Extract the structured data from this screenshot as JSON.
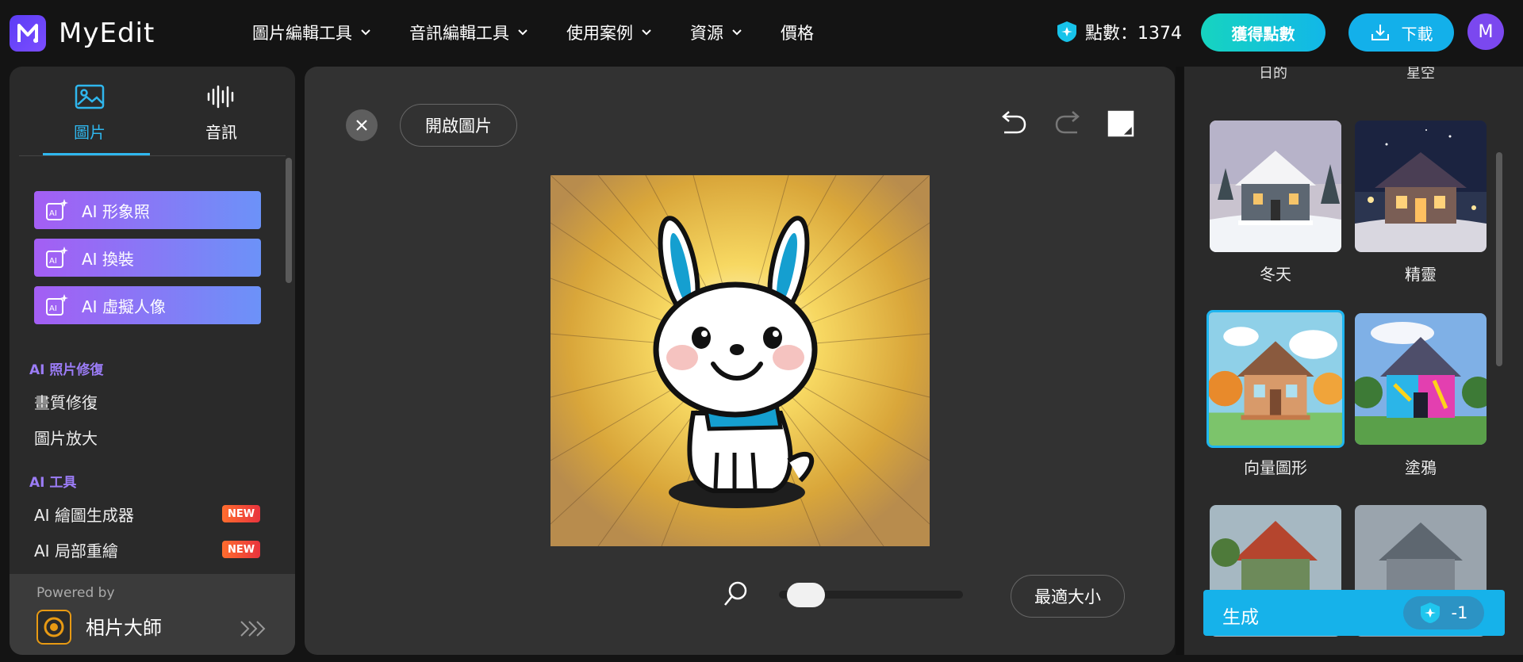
{
  "app": {
    "name": "MyEdit"
  },
  "nav": [
    {
      "label": "圖片編輯工具",
      "dropdown": true
    },
    {
      "label": "音訊編輯工具",
      "dropdown": true
    },
    {
      "label": "使用案例",
      "dropdown": true
    },
    {
      "label": "資源",
      "dropdown": true
    },
    {
      "label": "價格",
      "dropdown": false
    }
  ],
  "header": {
    "points_label": "點數：1374",
    "get_points": "獲得點數",
    "download": "下載",
    "avatar_initial": "M"
  },
  "left_panel": {
    "tabs": [
      {
        "label": "圖片",
        "active": true,
        "icon": "image-icon"
      },
      {
        "label": "音訊",
        "active": false,
        "icon": "audio-wave-icon"
      }
    ],
    "ai_buttons": [
      "AI 形象照",
      "AI 換裝",
      "AI 虛擬人像"
    ],
    "section_photo_repair": "AI 照片修復",
    "photo_repair_items": [
      "畫質修復",
      "圖片放大"
    ],
    "section_ai_tools": "AI 工具",
    "ai_tools_items": [
      {
        "label": "AI 繪圖生成器",
        "badge": "NEW"
      },
      {
        "label": "AI 局部重繪",
        "badge": "NEW"
      }
    ],
    "powered_by": "Powered by",
    "powered_product": "相片大師"
  },
  "canvas": {
    "open_image": "開啟圖片",
    "fit_size": "最適大小",
    "zoom_fraction": 0.05
  },
  "right_panel": {
    "cut_labels": [
      "日的",
      "星空"
    ],
    "styles": [
      {
        "label": "冬天",
        "selected": false
      },
      {
        "label": "精靈",
        "selected": false
      },
      {
        "label": "向量圖形",
        "selected": true
      },
      {
        "label": "塗鴉",
        "selected": false
      }
    ],
    "generate": "生成",
    "generate_cost": "-1"
  },
  "colors": {
    "accent": "#16b2ea",
    "purple": "#9b7cf6",
    "new_badge": "#ff6d2e"
  }
}
